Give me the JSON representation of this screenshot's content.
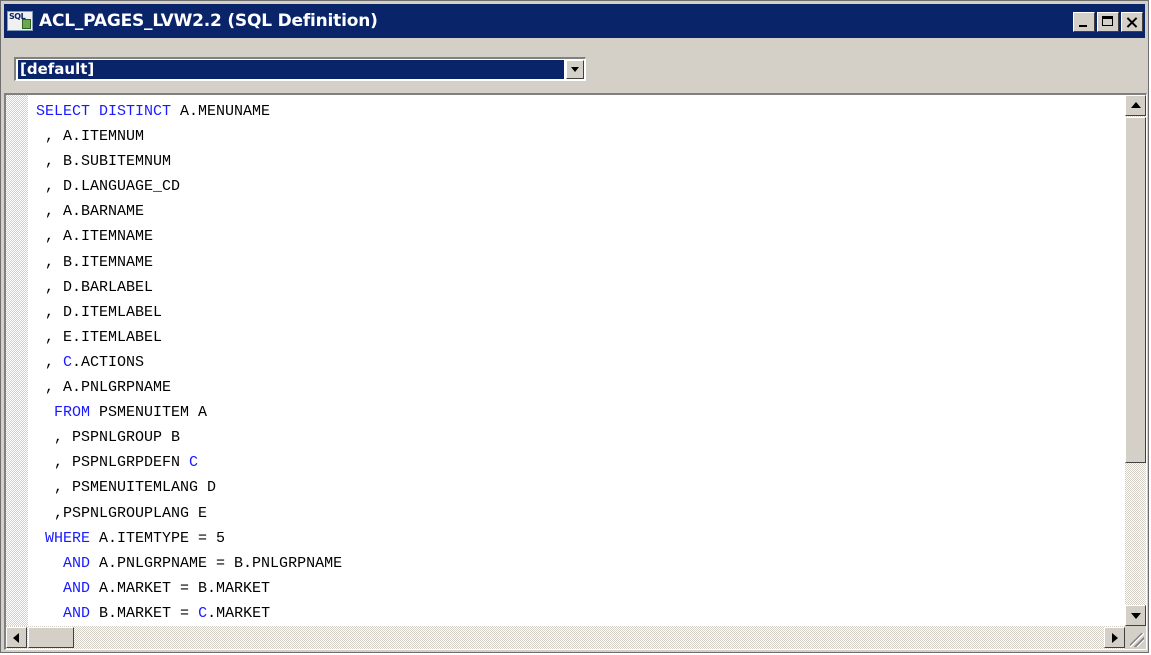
{
  "window": {
    "title": "ACL_PAGES_LVW2.2 (SQL Definition)",
    "icon": "sql-document-icon",
    "icon_text": "SQL"
  },
  "toolbar": {
    "combo_value": "[default]"
  },
  "colors": {
    "titlebar": "#0a246a",
    "keyword": "#1a1aff",
    "chrome": "#d4d0c8"
  },
  "code_lines": [
    [
      {
        "t": "SELECT DISTINCT",
        "k": true
      },
      {
        "t": " A.MENUNAME",
        "k": false
      }
    ],
    [
      {
        "t": " , A.ITEMNUM",
        "k": false
      }
    ],
    [
      {
        "t": " , B.SUBITEMNUM",
        "k": false
      }
    ],
    [
      {
        "t": " , D.LANGUAGE_CD",
        "k": false
      }
    ],
    [
      {
        "t": " , A.BARNAME",
        "k": false
      }
    ],
    [
      {
        "t": " , A.ITEMNAME",
        "k": false
      }
    ],
    [
      {
        "t": " , B.ITEMNAME",
        "k": false
      }
    ],
    [
      {
        "t": " , D.BARLABEL",
        "k": false
      }
    ],
    [
      {
        "t": " , D.ITEMLABEL",
        "k": false
      }
    ],
    [
      {
        "t": " , E.ITEMLABEL",
        "k": false
      }
    ],
    [
      {
        "t": " , ",
        "k": false
      },
      {
        "t": "C",
        "k": true
      },
      {
        "t": ".ACTIONS",
        "k": false
      }
    ],
    [
      {
        "t": " , A.PNLGRPNAME",
        "k": false
      }
    ],
    [
      {
        "t": "  ",
        "k": false
      },
      {
        "t": "FROM",
        "k": true
      },
      {
        "t": " PSMENUITEM A",
        "k": false
      }
    ],
    [
      {
        "t": "  , PSPNLGROUP B",
        "k": false
      }
    ],
    [
      {
        "t": "  , PSPNLGRPDEFN ",
        "k": false
      },
      {
        "t": "C",
        "k": true
      }
    ],
    [
      {
        "t": "  , PSMENUITEMLANG D",
        "k": false
      }
    ],
    [
      {
        "t": "  ,PSPNLGROUPLANG E",
        "k": false
      }
    ],
    [
      {
        "t": " ",
        "k": false
      },
      {
        "t": "WHERE",
        "k": true
      },
      {
        "t": " A.ITEMTYPE = 5",
        "k": false
      }
    ],
    [
      {
        "t": "   ",
        "k": false
      },
      {
        "t": "AND",
        "k": true
      },
      {
        "t": " A.PNLGRPNAME = B.PNLGRPNAME",
        "k": false
      }
    ],
    [
      {
        "t": "   ",
        "k": false
      },
      {
        "t": "AND",
        "k": true
      },
      {
        "t": " A.MARKET = B.MARKET",
        "k": false
      }
    ],
    [
      {
        "t": "   ",
        "k": false
      },
      {
        "t": "AND",
        "k": true
      },
      {
        "t": " B.MARKET = ",
        "k": false
      },
      {
        "t": "C",
        "k": true
      },
      {
        "t": ".MARKET",
        "k": false
      }
    ]
  ],
  "scrollbars": {
    "vertical_thumb_fraction": 0.68,
    "horizontal_thumb_fraction": 0.04
  }
}
